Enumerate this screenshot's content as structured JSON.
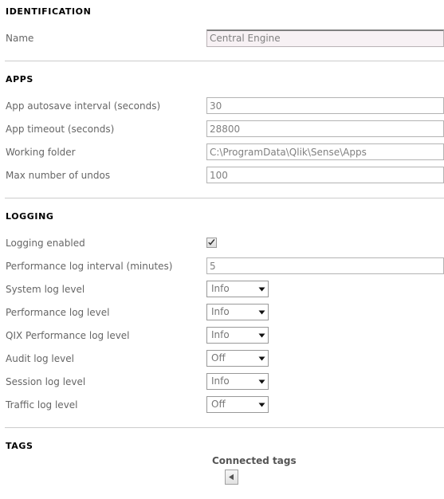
{
  "sections": [
    {
      "id": "identification",
      "title": "IDENTIFICATION",
      "fields": [
        {
          "label": "Name",
          "type": "text",
          "value": "Central Engine",
          "readonly": true
        }
      ]
    },
    {
      "id": "apps",
      "title": "APPS",
      "fields": [
        {
          "label": "App autosave interval (seconds)",
          "type": "text",
          "value": "30"
        },
        {
          "label": "App timeout (seconds)",
          "type": "text",
          "value": "28800"
        },
        {
          "label": "Working folder",
          "type": "text",
          "value": "C:\\ProgramData\\Qlik\\Sense\\Apps"
        },
        {
          "label": "Max number of undos",
          "type": "text",
          "value": "100"
        }
      ]
    },
    {
      "id": "logging",
      "title": "LOGGING",
      "fields": [
        {
          "label": "Logging enabled",
          "type": "checkbox",
          "checked": true
        },
        {
          "label": "Performance log interval (minutes)",
          "type": "text",
          "value": "5"
        },
        {
          "label": "System log level",
          "type": "select",
          "value": "Info"
        },
        {
          "label": "Performance log level",
          "type": "select",
          "value": "Info"
        },
        {
          "label": "QIX Performance log level",
          "type": "select",
          "value": "Info"
        },
        {
          "label": "Audit log level",
          "type": "select",
          "value": "Off"
        },
        {
          "label": "Session log level",
          "type": "select",
          "value": "Info"
        },
        {
          "label": "Traffic log level",
          "type": "select",
          "value": "Off"
        }
      ]
    },
    {
      "id": "tags",
      "title": "TAGS",
      "connected_tags_label": "Connected tags",
      "move_left_icon": "triangle-left-icon"
    }
  ],
  "colors": {
    "label_text": "#666666",
    "heading_text": "#000000",
    "input_border": "#b3b3b3",
    "divider": "#cccccc",
    "readonly_bg": "#f7f1f4",
    "select_text": "#777777"
  },
  "icons": {
    "chevron_down": "chevron-down-icon",
    "check": "check-icon",
    "triangle_left": "triangle-left-icon"
  }
}
